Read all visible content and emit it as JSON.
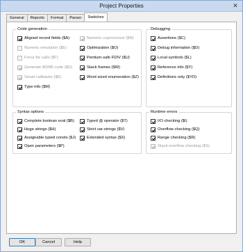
{
  "window": {
    "title": "Project Properties",
    "close_glyph": "✕"
  },
  "tabs": [
    {
      "label": "General"
    },
    {
      "label": "Reports"
    },
    {
      "label": "Format"
    },
    {
      "label": "Parser"
    },
    {
      "label": "Switches",
      "active": true
    }
  ],
  "code_generation": {
    "title": "Code generation",
    "items": [
      {
        "label": "Aligned record fields ($A)",
        "checked": true,
        "enabled": true
      },
      {
        "label": "Numeric emulation ($E)",
        "checked": false,
        "enabled": false
      },
      {
        "label": "Force far calls ($F)",
        "checked": false,
        "enabled": false
      },
      {
        "label": "Generate 80286 code ($G)",
        "checked": true,
        "enabled": false
      },
      {
        "label": "Smart callbacks ($K)",
        "checked": true,
        "enabled": false
      },
      {
        "label": "Type info ($M)",
        "checked": true,
        "enabled": true
      },
      {
        "label": "Numeric coprocessor ($N)",
        "checked": true,
        "enabled": false
      },
      {
        "label": "Optimization ($O)",
        "checked": true,
        "enabled": true
      },
      {
        "label": "Pentium-safe FDIV ($U)",
        "checked": true,
        "enabled": true
      },
      {
        "label": "Stack frames ($W)",
        "checked": true,
        "enabled": true
      },
      {
        "label": "Word sized enumeration ($Z)",
        "checked": true,
        "enabled": true
      }
    ]
  },
  "debugging": {
    "title": "Debugging",
    "items": [
      {
        "label": "Assertions ($C)",
        "checked": true,
        "enabled": true
      },
      {
        "label": "Debug information ($D)",
        "checked": true,
        "enabled": true
      },
      {
        "label": "Local symbols ($L)",
        "checked": true,
        "enabled": true
      },
      {
        "label": "Reference info ($Y)",
        "checked": true,
        "enabled": true
      },
      {
        "label": "Definitions only ($YD)",
        "checked": true,
        "enabled": true
      }
    ]
  },
  "syntax_options": {
    "title": "Syntax options",
    "items": [
      {
        "label": "Complete boolean eval ($B)",
        "checked": true,
        "enabled": true
      },
      {
        "label": "Huge strings ($H)",
        "checked": true,
        "enabled": true
      },
      {
        "label": "Assignable typed consts ($J)",
        "checked": true,
        "enabled": true
      },
      {
        "label": "Open parameters ($P)",
        "checked": true,
        "enabled": true
      },
      {
        "label": "Typed @ operator ($T)",
        "checked": true,
        "enabled": true
      },
      {
        "label": "Strict var-strings ($V)",
        "checked": true,
        "enabled": true
      },
      {
        "label": "Extended syntax ($X)",
        "checked": true,
        "enabled": true
      }
    ]
  },
  "runtime_errors": {
    "title": "Runtime errors",
    "items": [
      {
        "label": "I/O checking ($I)",
        "checked": true,
        "enabled": true
      },
      {
        "label": "Overflow checking ($Q)",
        "checked": true,
        "enabled": true
      },
      {
        "label": "Range checking ($R)",
        "checked": true,
        "enabled": true
      },
      {
        "label": "Stack-overflow checking ($S)",
        "checked": true,
        "enabled": false
      }
    ]
  },
  "buttons": {
    "ok": "OK",
    "cancel": "Cancel",
    "help": "Help"
  }
}
